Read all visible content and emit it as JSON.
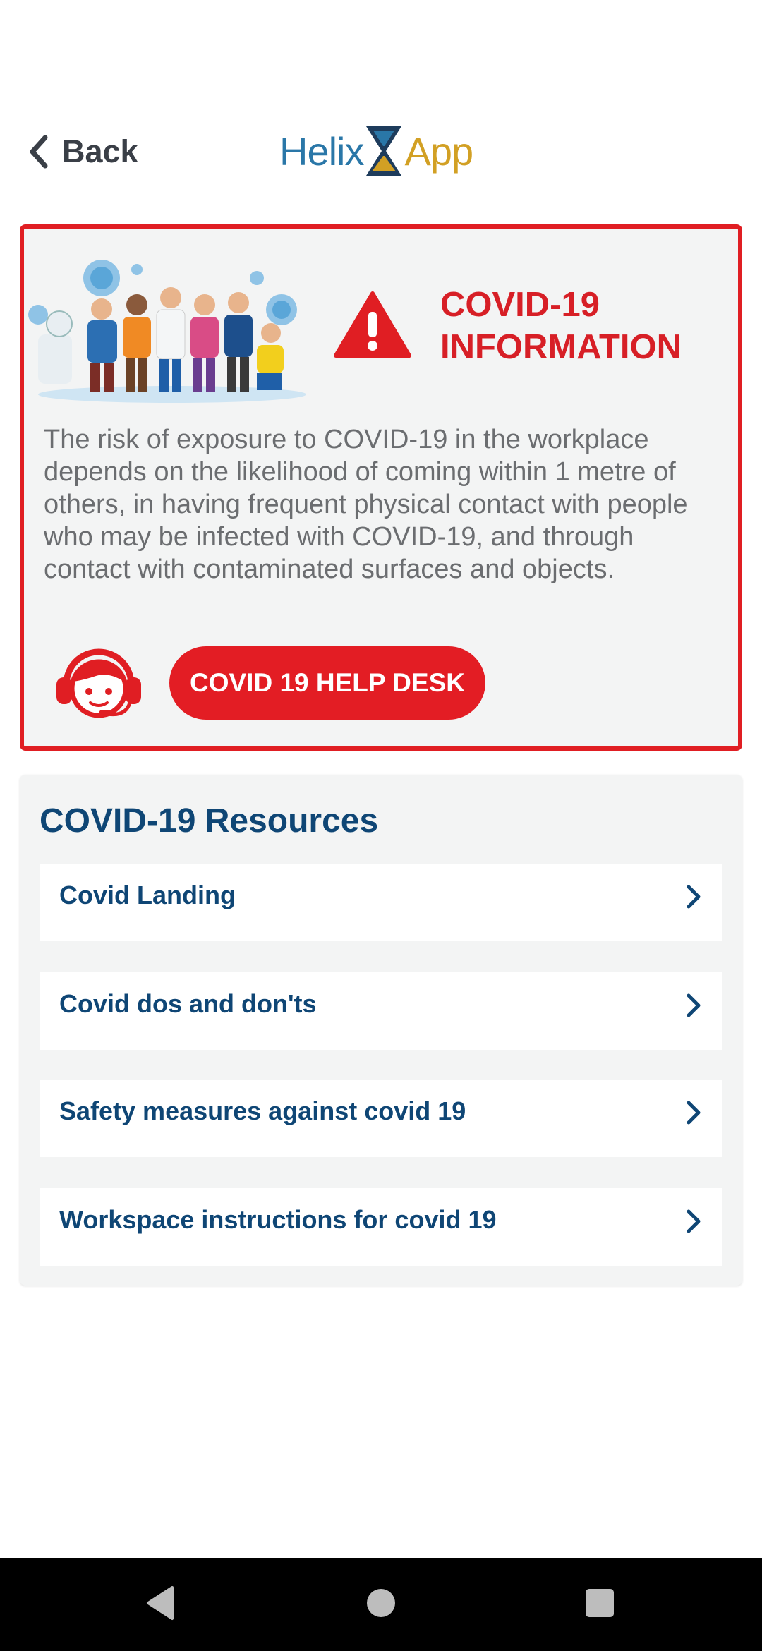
{
  "header": {
    "back_label": "Back",
    "logo_left": "Helix",
    "logo_right": "App"
  },
  "info": {
    "title_line1": "COVID-19",
    "title_line2": "INFORMATION",
    "body": "The risk of exposure to COVID-19 in the workplace depends on the likelihood of coming within 1 metre of others, in having frequent physical contact with people who may be infected with COVID-19, and through contact with contaminated surfaces and objects.",
    "helpdesk_label": "COVID 19 HELP DESK"
  },
  "resources": {
    "title": "COVID-19 Resources",
    "items": [
      {
        "label": "Covid Landing"
      },
      {
        "label": "Covid dos and don'ts"
      },
      {
        "label": "Safety measures against covid 19"
      },
      {
        "label": "Workspace instructions for covid 19"
      }
    ]
  },
  "colors": {
    "accent_red": "#e31d24",
    "navy": "#0f4675",
    "logo_blue": "#2a77a8",
    "logo_gold": "#d2a024"
  },
  "icons": {
    "back": "chevron-left-icon",
    "warning": "warning-icon",
    "agent": "support-agent-icon",
    "item_chevron": "chevron-right-icon",
    "nav_back": "nav-back-icon",
    "nav_home": "nav-home-icon",
    "nav_recents": "nav-recents-icon"
  }
}
